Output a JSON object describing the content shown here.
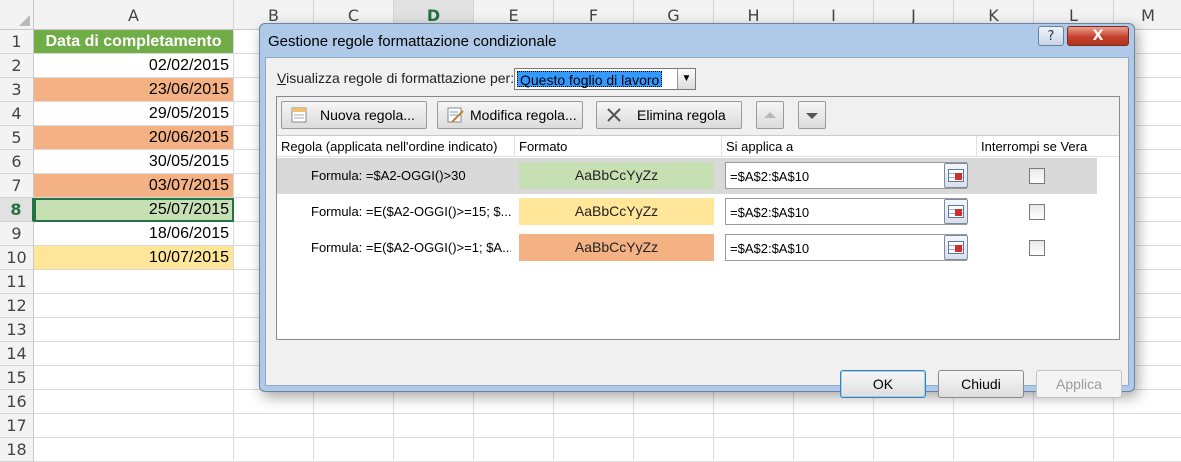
{
  "sheet": {
    "columns": [
      "A",
      "B",
      "C",
      "D",
      "E",
      "F",
      "G",
      "H",
      "I",
      "J",
      "K",
      "L",
      "M"
    ],
    "selected_column": "D",
    "rows": [
      "1",
      "2",
      "3",
      "4",
      "5",
      "6",
      "7",
      "8",
      "9",
      "10",
      "11",
      "12",
      "13",
      "14",
      "15",
      "16",
      "17",
      "18"
    ],
    "selected_row": "8",
    "header_cell": "Data di completamento",
    "cells": [
      {
        "value": "02/02/2015",
        "fill": "none"
      },
      {
        "value": "23/06/2015",
        "fill": "orange"
      },
      {
        "value": "29/05/2015",
        "fill": "none"
      },
      {
        "value": "20/06/2015",
        "fill": "orange"
      },
      {
        "value": "30/05/2015",
        "fill": "none"
      },
      {
        "value": "03/07/2015",
        "fill": "orange"
      },
      {
        "value": "25/07/2015",
        "fill": "green"
      },
      {
        "value": "18/06/2015",
        "fill": "none"
      },
      {
        "value": "10/07/2015",
        "fill": "yellow"
      }
    ],
    "colors": {
      "header": "#70ad47",
      "green": "#c6e0b4",
      "orange": "#f4b183",
      "yellow": "#ffe699",
      "accent": "#217346"
    }
  },
  "dialog": {
    "title": "Gestione regole formattazione condizionale",
    "help_label": "?",
    "close_label": "X",
    "show_rules_label": "Visualizza regole di formattazione per:",
    "show_rules_value": "Questo foglio di lavoro",
    "toolbar": {
      "new_rule": "Nuova regola...",
      "edit_rule": "Modifica regola...",
      "delete_rule": "Elimina regola"
    },
    "columns": {
      "rule": "Regola (applicata nell'ordine indicato)",
      "format": "Formato",
      "applies_to": "Si applica a",
      "stop_if_true": "Interrompi se Vera"
    },
    "rules": [
      {
        "formula": "Formula: =$A2-OGGI()>30",
        "preview": "AaBbCcYyZz",
        "preview_color": "#c6e0b4",
        "applies_to": "=$A$2:$A$10",
        "stop_if_true": false,
        "selected": true
      },
      {
        "formula": "Formula: =E($A2-OGGI()>=15; $...",
        "preview": "AaBbCcYyZz",
        "preview_color": "#ffe699",
        "applies_to": "=$A$2:$A$10",
        "stop_if_true": false,
        "selected": false
      },
      {
        "formula": "Formula: =E($A2-OGGI()>=1; $A...",
        "preview": "AaBbCcYyZz",
        "preview_color": "#f4b183",
        "applies_to": "=$A$2:$A$10",
        "stop_if_true": false,
        "selected": false
      }
    ],
    "buttons": {
      "ok": "OK",
      "close": "Chiudi",
      "apply": "Applica"
    }
  }
}
